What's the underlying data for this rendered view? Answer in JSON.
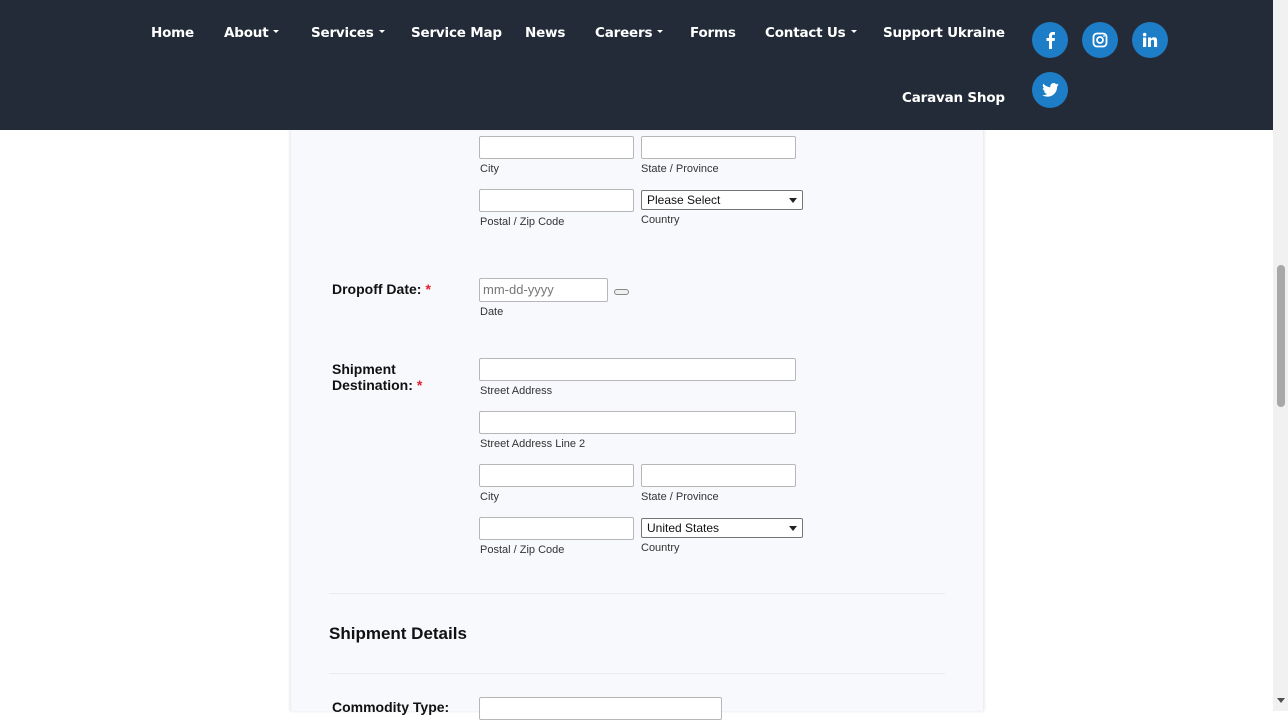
{
  "nav": {
    "home": "Home",
    "about": "About",
    "services": "Services",
    "service_map": "Service Map",
    "news": "News",
    "careers": "Careers",
    "forms": "Forms",
    "contact_us": "Contact Us",
    "support_ukraine": "Support Ukraine",
    "caravan_shop": "Caravan Shop"
  },
  "social": {
    "icons": [
      "facebook-icon",
      "instagram-icon",
      "linkedin-icon",
      "twitter-icon"
    ],
    "color": "#1d7dc6"
  },
  "colors": {
    "header_bg": "#222b37",
    "required": "#e4202c",
    "card_bg": "#f8f9fc"
  },
  "form": {
    "origin": {
      "city_sub": "City",
      "state_sub": "State / Province",
      "zip_sub": "Postal / Zip Code",
      "country_value": "Please Select",
      "country_sub": "Country"
    },
    "dropoff": {
      "label": "Dropoff Date:",
      "required_mark": "*",
      "placeholder": "mm-dd-yyyy",
      "sub": "Date"
    },
    "destination": {
      "label_line1": "Shipment",
      "label_line2": "Destination:",
      "required_mark": "*",
      "street_sub": "Street Address",
      "street2_sub": "Street Address Line 2",
      "city_sub": "City",
      "state_sub": "State / Province",
      "zip_sub": "Postal / Zip Code",
      "country_value": "United States",
      "country_sub": "Country"
    },
    "details": {
      "section_title": "Shipment Details",
      "commodity_label": "Commodity Type:"
    }
  }
}
